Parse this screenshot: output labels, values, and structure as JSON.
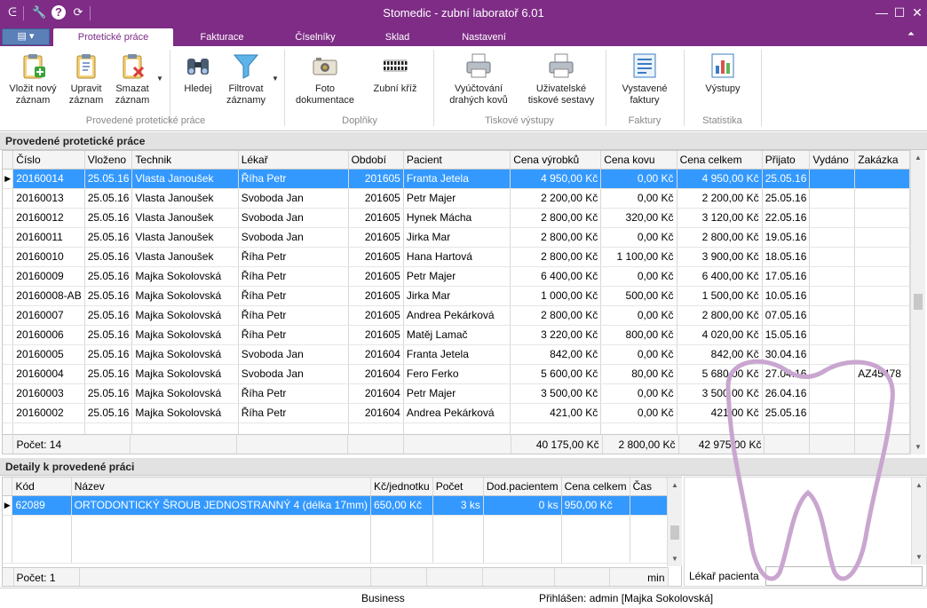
{
  "window": {
    "title": "Stomedic - zubní laboratoř  6.01",
    "minimize": "—",
    "maximize": "☐",
    "close": "✕"
  },
  "quick_access": {
    "tools": "🔧",
    "help": "?",
    "refresh": "⟳",
    "logo": "ᕮ"
  },
  "app_menu": {
    "label": "▤ ▾"
  },
  "collapse_ribbon": "⏶",
  "tabs": [
    {
      "label": "Protetické práce"
    },
    {
      "label": "Fakturace"
    },
    {
      "label": "Číselníky"
    },
    {
      "label": "Sklad"
    },
    {
      "label": "Nastavení"
    }
  ],
  "ribbon": {
    "buttons": {
      "insert": "Vložit nový záznam",
      "edit": "Upravit záznam",
      "delete": "Smazat záznam",
      "search": "Hledej",
      "filter": "Filtrovat záznamy",
      "photo": "Foto dokumentace",
      "tooth_cross": "Zubní kříž",
      "billing": "Vyúčtování drahých kovů",
      "user_print": "Uživatelské tiskové sestavy",
      "issued_invoices": "Vystavené faktury",
      "outputs": "Výstupy"
    },
    "groups": {
      "work": "Provedené protetické práce",
      "addons": "Doplňky",
      "print": "Tiskové výstupy",
      "invoices": "Faktury",
      "stats": "Statistika"
    }
  },
  "works_panel": {
    "title": "Provedené protetické práce",
    "columns": [
      "Číslo",
      "Vloženo",
      "Technik",
      "Lékař",
      "Období",
      "Pacient",
      "Cena výrobků",
      "Cena kovu",
      "Cena celkem",
      "Přijato",
      "Vydáno",
      "Zakázka"
    ],
    "rows": [
      [
        "20160014",
        "25.05.16",
        "Vlasta Janoušek",
        "Říha Petr",
        "201605",
        "Franta Jetela",
        "4 950,00 Kč",
        "0,00 Kč",
        "4 950,00 Kč",
        "25.05.16",
        "",
        ""
      ],
      [
        "20160013",
        "25.05.16",
        "Vlasta Janoušek",
        "Svoboda Jan",
        "201605",
        "Petr Majer",
        "2 200,00 Kč",
        "0,00 Kč",
        "2 200,00 Kč",
        "25.05.16",
        "",
        ""
      ],
      [
        "20160012",
        "25.05.16",
        "Vlasta Janoušek",
        "Svoboda Jan",
        "201605",
        "Hynek Mácha",
        "2 800,00 Kč",
        "320,00 Kč",
        "3 120,00 Kč",
        "22.05.16",
        "",
        ""
      ],
      [
        "20160011",
        "25.05.16",
        "Vlasta Janoušek",
        "Svoboda Jan",
        "201605",
        "Jirka Mar",
        "2 800,00 Kč",
        "0,00 Kč",
        "2 800,00 Kč",
        "19.05.16",
        "",
        ""
      ],
      [
        "20160010",
        "25.05.16",
        "Vlasta Janoušek",
        "Říha Petr",
        "201605",
        "Hana Hartová",
        "2 800,00 Kč",
        "1 100,00 Kč",
        "3 900,00 Kč",
        "18.05.16",
        "",
        ""
      ],
      [
        "20160009",
        "25.05.16",
        "Majka Sokolovská",
        "Říha Petr",
        "201605",
        "Petr Majer",
        "6 400,00 Kč",
        "0,00 Kč",
        "6 400,00 Kč",
        "17.05.16",
        "",
        ""
      ],
      [
        "20160008-AB",
        "25.05.16",
        "Majka Sokolovská",
        "Říha Petr",
        "201605",
        "Jirka Mar",
        "1 000,00 Kč",
        "500,00 Kč",
        "1 500,00 Kč",
        "10.05.16",
        "",
        ""
      ],
      [
        "20160007",
        "25.05.16",
        "Majka Sokolovská",
        "Říha Petr",
        "201605",
        "Andrea Pekárková",
        "2 800,00 Kč",
        "0,00 Kč",
        "2 800,00 Kč",
        "07.05.16",
        "",
        ""
      ],
      [
        "20160006",
        "25.05.16",
        "Majka Sokolovská",
        "Říha Petr",
        "201605",
        "Matěj Lamač",
        "3 220,00 Kč",
        "800,00 Kč",
        "4 020,00 Kč",
        "15.05.16",
        "",
        ""
      ],
      [
        "20160005",
        "25.05.16",
        "Majka Sokolovská",
        "Svoboda Jan",
        "201604",
        "Franta Jetela",
        "842,00 Kč",
        "0,00 Kč",
        "842,00 Kč",
        "30.04.16",
        "",
        ""
      ],
      [
        "20160004",
        "25.05.16",
        "Majka Sokolovská",
        "Svoboda Jan",
        "201604",
        "Fero Ferko",
        "5 600,00 Kč",
        "80,00 Kč",
        "5 680,00 Kč",
        "27.04.16",
        "",
        "AZ45478"
      ],
      [
        "20160003",
        "25.05.16",
        "Majka Sokolovská",
        "Říha Petr",
        "201604",
        "Petr Majer",
        "3 500,00 Kč",
        "0,00 Kč",
        "3 500,00 Kč",
        "26.04.16",
        "",
        ""
      ],
      [
        "20160002",
        "25.05.16",
        "Majka Sokolovská",
        "Říha Petr",
        "201604",
        "Andrea Pekárková",
        "421,00 Kč",
        "0,00 Kč",
        "421,00 Kč",
        "25.05.16",
        "",
        ""
      ]
    ],
    "footer": {
      "count": "Počet:  14",
      "sum_products": "40 175,00 Kč",
      "sum_metal": "2 800,00 Kč",
      "sum_total": "42 975,00 Kč"
    }
  },
  "details_panel": {
    "title": "Detaily k provedené práci",
    "columns": [
      "Kód",
      "Název",
      "Kč/jednotku",
      "Počet",
      "Dod.pacientem",
      "Cena celkem",
      "Čas"
    ],
    "rows": [
      [
        "62089",
        "ORTODONTICKÝ ŠROUB JEDNOSTRANNÝ 4 (délka 17mm)",
        "650,00 Kč",
        "3 ks",
        "0 ks",
        "950,00 Kč",
        ""
      ]
    ],
    "footer": {
      "count": "Počet:  1",
      "time_unit": "min"
    }
  },
  "side_panel": {
    "doctor_label": "Lékař pacienta",
    "doctor_value": ""
  },
  "status": {
    "edition": "Business",
    "login": "Přihlášen: admin [Majka Sokolovská]"
  },
  "colors": {
    "accent": "#7e2c86",
    "selection": "#3399ff",
    "tooth_watermark": "#c9a6d0"
  }
}
